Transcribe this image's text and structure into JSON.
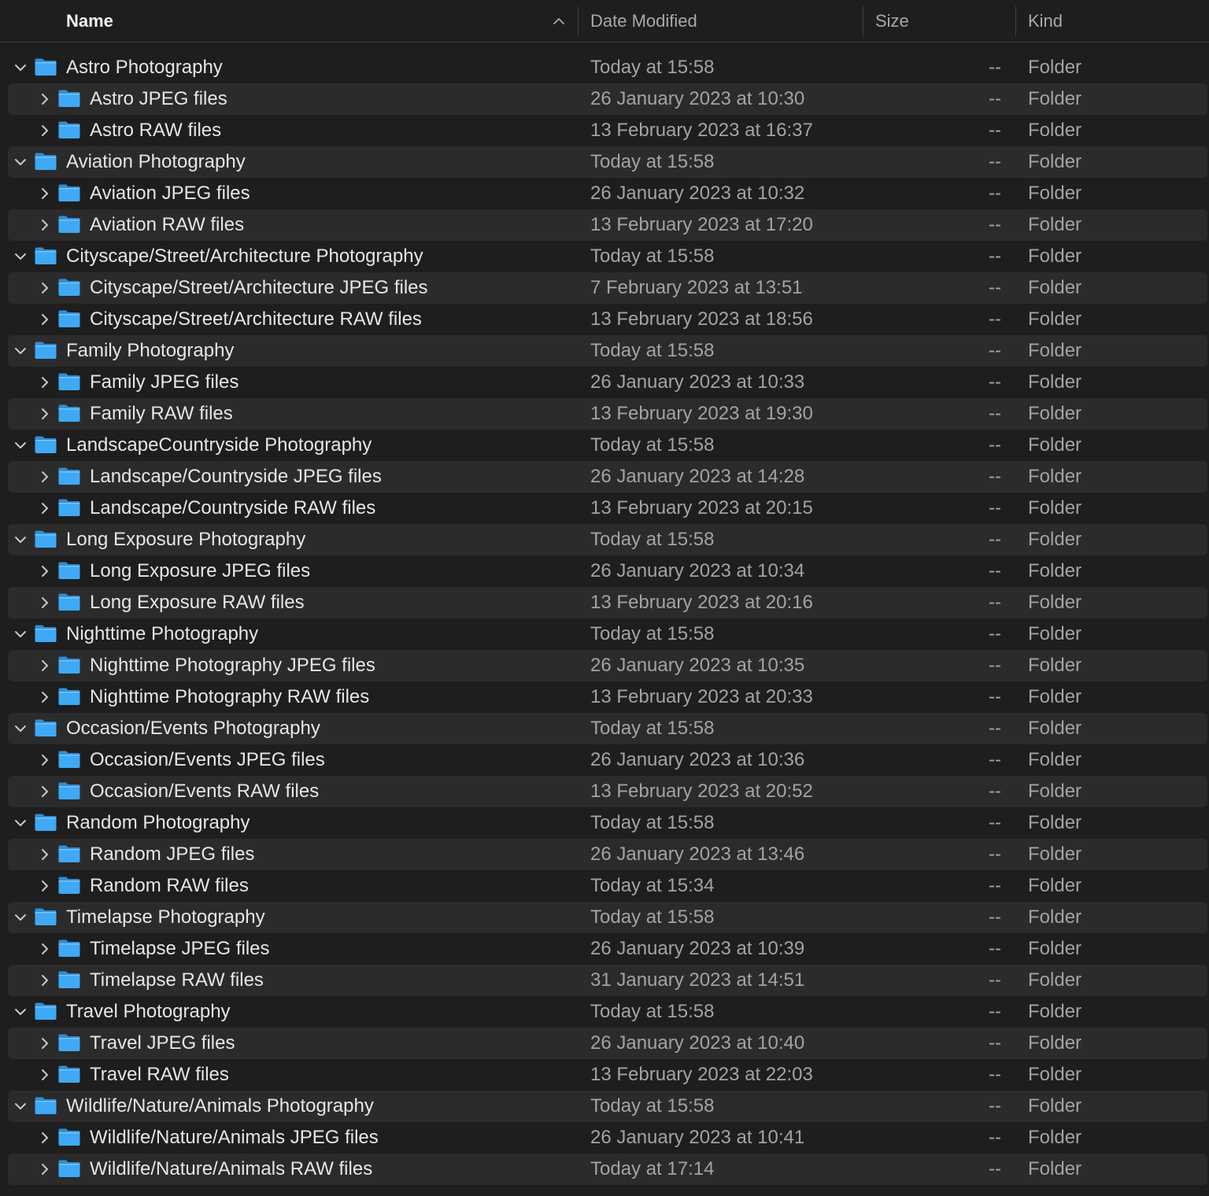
{
  "header": {
    "name_label": "Name",
    "date_label": "Date Modified",
    "size_label": "Size",
    "kind_label": "Kind",
    "sort_icon": "chevron-up-icon"
  },
  "colors": {
    "background": "#1e1e1e",
    "stripe": "#2b2b2b",
    "folder_blue": "#3fa9f5",
    "primary_text": "#e6e6e6",
    "secondary_text": "#a3a3a3"
  },
  "rows": [
    {
      "level": 0,
      "expanded": true,
      "name": "Astro Photography",
      "date": "Today at 15:58",
      "size": "--",
      "kind": "Folder"
    },
    {
      "level": 1,
      "expanded": false,
      "name": "Astro JPEG files",
      "date": "26 January 2023 at 10:30",
      "size": "--",
      "kind": "Folder"
    },
    {
      "level": 1,
      "expanded": false,
      "name": "Astro RAW files",
      "date": "13 February 2023 at 16:37",
      "size": "--",
      "kind": "Folder"
    },
    {
      "level": 0,
      "expanded": true,
      "name": "Aviation Photography",
      "date": "Today at 15:58",
      "size": "--",
      "kind": "Folder"
    },
    {
      "level": 1,
      "expanded": false,
      "name": "Aviation JPEG files",
      "date": "26 January 2023 at 10:32",
      "size": "--",
      "kind": "Folder"
    },
    {
      "level": 1,
      "expanded": false,
      "name": "Aviation RAW files",
      "date": "13 February 2023 at 17:20",
      "size": "--",
      "kind": "Folder"
    },
    {
      "level": 0,
      "expanded": true,
      "name": "Cityscape/Street/Architecture Photography",
      "date": "Today at 15:58",
      "size": "--",
      "kind": "Folder"
    },
    {
      "level": 1,
      "expanded": false,
      "name": "Cityscape/Street/Architecture JPEG files",
      "date": "7 February 2023 at 13:51",
      "size": "--",
      "kind": "Folder"
    },
    {
      "level": 1,
      "expanded": false,
      "name": "Cityscape/Street/Architecture RAW files",
      "date": "13 February 2023 at 18:56",
      "size": "--",
      "kind": "Folder"
    },
    {
      "level": 0,
      "expanded": true,
      "name": "Family Photography",
      "date": "Today at 15:58",
      "size": "--",
      "kind": "Folder"
    },
    {
      "level": 1,
      "expanded": false,
      "name": "Family JPEG files",
      "date": "26 January 2023 at 10:33",
      "size": "--",
      "kind": "Folder"
    },
    {
      "level": 1,
      "expanded": false,
      "name": "Family RAW files",
      "date": "13 February 2023 at 19:30",
      "size": "--",
      "kind": "Folder"
    },
    {
      "level": 0,
      "expanded": true,
      "name": "LandscapeCountryside Photography",
      "date": "Today at 15:58",
      "size": "--",
      "kind": "Folder"
    },
    {
      "level": 1,
      "expanded": false,
      "name": "Landscape/Countryside JPEG files",
      "date": "26 January 2023 at 14:28",
      "size": "--",
      "kind": "Folder"
    },
    {
      "level": 1,
      "expanded": false,
      "name": "Landscape/Countryside RAW files",
      "date": "13 February 2023 at 20:15",
      "size": "--",
      "kind": "Folder"
    },
    {
      "level": 0,
      "expanded": true,
      "name": "Long Exposure Photography",
      "date": "Today at 15:58",
      "size": "--",
      "kind": "Folder"
    },
    {
      "level": 1,
      "expanded": false,
      "name": "Long Exposure JPEG files",
      "date": "26 January 2023 at 10:34",
      "size": "--",
      "kind": "Folder"
    },
    {
      "level": 1,
      "expanded": false,
      "name": "Long Exposure RAW files",
      "date": "13 February 2023 at 20:16",
      "size": "--",
      "kind": "Folder"
    },
    {
      "level": 0,
      "expanded": true,
      "name": "Nighttime Photography",
      "date": "Today at 15:58",
      "size": "--",
      "kind": "Folder"
    },
    {
      "level": 1,
      "expanded": false,
      "name": "Nighttime Photography JPEG files",
      "date": "26 January 2023 at 10:35",
      "size": "--",
      "kind": "Folder"
    },
    {
      "level": 1,
      "expanded": false,
      "name": "Nighttime Photography RAW files",
      "date": "13 February 2023 at 20:33",
      "size": "--",
      "kind": "Folder"
    },
    {
      "level": 0,
      "expanded": true,
      "name": "Occasion/Events Photography",
      "date": "Today at 15:58",
      "size": "--",
      "kind": "Folder"
    },
    {
      "level": 1,
      "expanded": false,
      "name": "Occasion/Events JPEG files",
      "date": "26 January 2023 at 10:36",
      "size": "--",
      "kind": "Folder"
    },
    {
      "level": 1,
      "expanded": false,
      "name": "Occasion/Events RAW files",
      "date": "13 February 2023 at 20:52",
      "size": "--",
      "kind": "Folder"
    },
    {
      "level": 0,
      "expanded": true,
      "name": "Random Photography",
      "date": "Today at 15:58",
      "size": "--",
      "kind": "Folder"
    },
    {
      "level": 1,
      "expanded": false,
      "name": "Random JPEG files",
      "date": "26 January 2023 at 13:46",
      "size": "--",
      "kind": "Folder"
    },
    {
      "level": 1,
      "expanded": false,
      "name": "Random RAW files",
      "date": "Today at 15:34",
      "size": "--",
      "kind": "Folder"
    },
    {
      "level": 0,
      "expanded": true,
      "name": "Timelapse Photography",
      "date": "Today at 15:58",
      "size": "--",
      "kind": "Folder"
    },
    {
      "level": 1,
      "expanded": false,
      "name": "Timelapse JPEG files",
      "date": "26 January 2023 at 10:39",
      "size": "--",
      "kind": "Folder"
    },
    {
      "level": 1,
      "expanded": false,
      "name": "Timelapse RAW files",
      "date": "31 January 2023 at 14:51",
      "size": "--",
      "kind": "Folder"
    },
    {
      "level": 0,
      "expanded": true,
      "name": "Travel Photography",
      "date": "Today at 15:58",
      "size": "--",
      "kind": "Folder"
    },
    {
      "level": 1,
      "expanded": false,
      "name": "Travel JPEG files",
      "date": "26 January 2023 at 10:40",
      "size": "--",
      "kind": "Folder"
    },
    {
      "level": 1,
      "expanded": false,
      "name": "Travel RAW files",
      "date": "13 February 2023 at 22:03",
      "size": "--",
      "kind": "Folder"
    },
    {
      "level": 0,
      "expanded": true,
      "name": "Wildlife/Nature/Animals Photography",
      "date": "Today at 15:58",
      "size": "--",
      "kind": "Folder"
    },
    {
      "level": 1,
      "expanded": false,
      "name": "Wildlife/Nature/Animals JPEG files",
      "date": "26 January 2023 at 10:41",
      "size": "--",
      "kind": "Folder"
    },
    {
      "level": 1,
      "expanded": false,
      "name": "Wildlife/Nature/Animals RAW files",
      "date": "Today at 17:14",
      "size": "--",
      "kind": "Folder"
    }
  ]
}
